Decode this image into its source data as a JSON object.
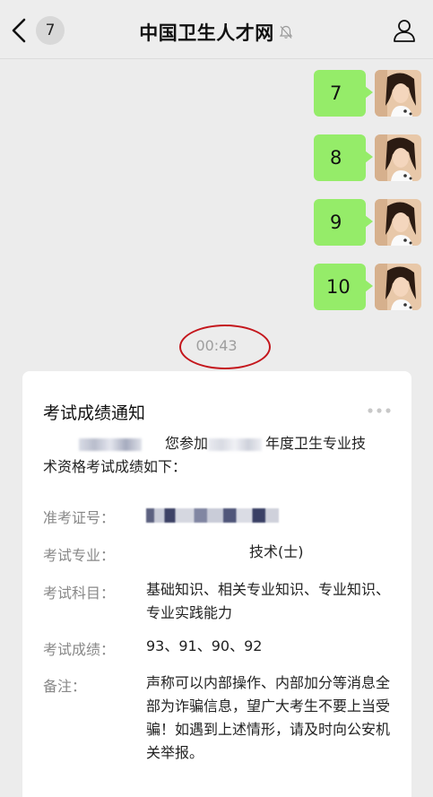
{
  "header": {
    "back_badge": "7",
    "title": "中国卫生人才网"
  },
  "messages": [
    {
      "text": "7"
    },
    {
      "text": "8"
    },
    {
      "text": "9"
    },
    {
      "text": "10"
    }
  ],
  "timestamp": "00:43",
  "card": {
    "title": "考试成绩通知",
    "intro_part1": "您参加",
    "intro_part2": "年度卫生专业技",
    "intro_line2": "术资格考试成绩如下：",
    "fields": {
      "ticket_label": "准考证号：",
      "major_label": "考试专业：",
      "major_value": "技术(士)",
      "subjects_label": "考试科目：",
      "subjects_value": "基础知识、相关专业知识、专业知识、专业实践能力",
      "scores_label": "考试成绩：",
      "scores_value": "93、91、90、92",
      "note_label": "备注：",
      "note_value": "声称可以内部操作、内部加分等消息全部为诈骗信息，望广大考生不要上当受骗！如遇到上述情形，请及时向公安机关举报。"
    }
  },
  "colors": {
    "bubble": "#95ec69",
    "annotation_circle": "#c4161c",
    "background": "#ececec"
  },
  "icons": [
    "back-chevron-icon",
    "mute-bell-icon",
    "profile-icon",
    "more-dots-icon"
  ]
}
